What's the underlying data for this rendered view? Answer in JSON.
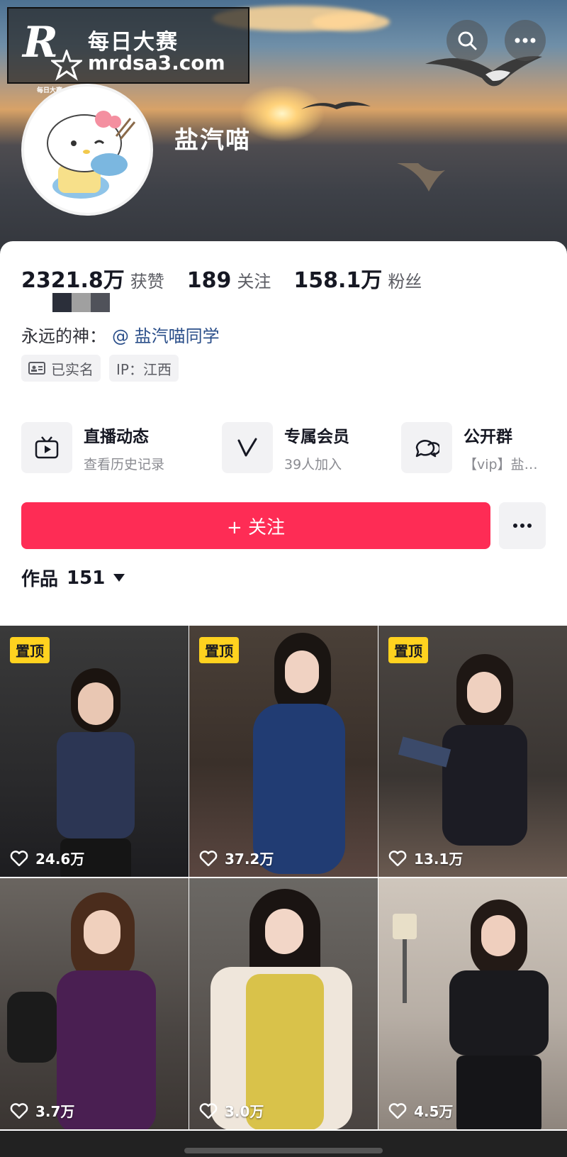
{
  "watermark": {
    "line1": "每日大赛",
    "line2": "mrdsa3.com",
    "logo_letter": "R",
    "logo_sub": "每日大赛"
  },
  "header": {
    "nickname": "盐汽喵",
    "icons": [
      "search-icon",
      "more-icon"
    ]
  },
  "stats": [
    {
      "value": "2321.8万",
      "label": "获赞"
    },
    {
      "value": "189",
      "label": "关注"
    },
    {
      "value": "158.1万",
      "label": "粉丝"
    }
  ],
  "bio": {
    "prefix": "永远的神：",
    "mention": "@ 盐汽喵同学"
  },
  "tags": [
    {
      "label": "已实名",
      "icon": "id-card-icon"
    },
    {
      "label": "IP：江西"
    }
  ],
  "features": [
    {
      "title": "直播动态",
      "subtitle": "查看历史记录",
      "icon": "tv-icon"
    },
    {
      "title": "专属会员",
      "subtitle": "39人加入",
      "icon": "v-icon"
    },
    {
      "title": "公开群",
      "subtitle": "【vip】盐…",
      "icon": "chat-bubble-icon"
    }
  ],
  "follow_button": "+ 关注",
  "works": {
    "label": "作品",
    "count": "151"
  },
  "videos": [
    {
      "pinned": "置顶",
      "likes": "24.6万"
    },
    {
      "pinned": "置顶",
      "likes": "37.2万"
    },
    {
      "pinned": "置顶",
      "likes": "13.1万"
    },
    {
      "pinned": "",
      "likes": "3.7万"
    },
    {
      "pinned": "",
      "likes": "3.0万"
    },
    {
      "pinned": "",
      "likes": "4.5万"
    }
  ],
  "colors": {
    "accent": "#fe2c55",
    "pin_badge": "#ffd21f",
    "mention": "#2b4f8a"
  }
}
